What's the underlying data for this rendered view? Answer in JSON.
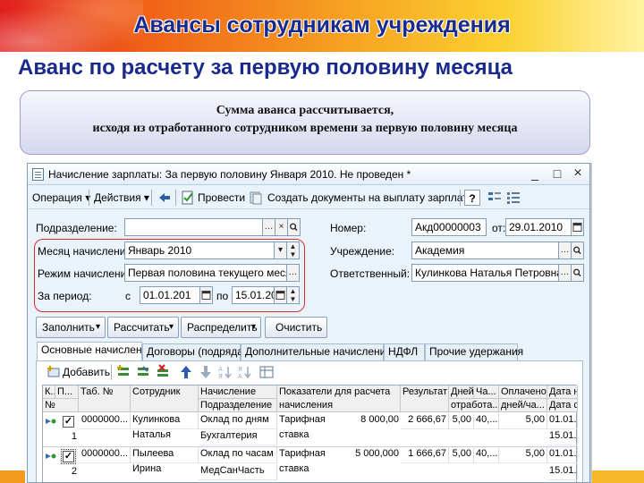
{
  "slide": {
    "title": "Авансы сотрудникам учреждения",
    "subtitle": "Аванс по расчету за первую половину месяца",
    "note_line1": "Сумма аванса рассчитывается,",
    "note_line2": "исходя из отработанного сотрудником времени за первую половину месяца"
  },
  "window": {
    "title": "Начисление зарплаты: За первую половину Января 2010. Не проведен *",
    "minimize": "_",
    "maximize": "□",
    "close": "×"
  },
  "toolbar": {
    "operation": "Операция ▾",
    "actions": "Действия ▾",
    "post": "Провести",
    "create_docs": "Создать документы на выплату зарплаты",
    "help": "?"
  },
  "form": {
    "department_label": "Подразделение:",
    "department_value": "",
    "number_label": "Номер:",
    "number_value": "Акд00000003",
    "date_label": "от:",
    "date_value": "29.01.2010",
    "month_label": "Месяц начисления:",
    "month_value": "Январь 2010",
    "institution_label": "Учреждение:",
    "institution_value": "Академия",
    "mode_label": "Режим начисления:",
    "mode_value": "Первая половина текущего месяца",
    "responsible_label": "Ответственный:",
    "responsible_value": "Кулинкова Наталья Петровна",
    "period_label": "За период:",
    "from_label": "с",
    "from_value": "01.01.201",
    "to_label": "по",
    "to_value": "15.01.20"
  },
  "actions": {
    "fill": "Заполнить",
    "calculate": "Рассчитать",
    "distribute": "Распределить",
    "clear": "Очистить"
  },
  "tabs": [
    {
      "label": "Основные начисления"
    },
    {
      "label": "Договоры (подряда)"
    },
    {
      "label": "Дополнительные начисления"
    },
    {
      "label": "НДФЛ"
    },
    {
      "label": "Прочие удержания"
    }
  ],
  "grid": {
    "add_label": "Добавить",
    "headers": {
      "k": "К...",
      "p": "П...",
      "no": "№",
      "tab": "Таб. №",
      "employee": "Сотрудник",
      "accrual": "Начисление",
      "department": "Подразделение",
      "indicators": "Показатели для расчета начисления",
      "result": "Результат",
      "days": "Дней",
      "days2": "отработа...",
      "ch": "Ча...",
      "paid": "Оплачено",
      "paid2": "дней/ча...",
      "date": "Дата н",
      "date2": "Дата с"
    },
    "rows": [
      {
        "no": "1",
        "checked": "✓",
        "tab": "0000000...",
        "employee1": "Кулинкова",
        "employee2": "Наталья",
        "accrual": "Оклад по дням",
        "department": "Бухгалтерия",
        "ind_name1": "Тарифная",
        "ind_name2": "ставка",
        "ind_value": "8 000,00",
        "result": "2 666,67",
        "days": "5,00",
        "hours": "40,...",
        "paid": "5,00",
        "date1": "01.01.",
        "date2": "15.01."
      },
      {
        "no": "2",
        "checked": "✓",
        "tab": "0000000...",
        "employee1": "Пылеева",
        "employee2": "Ирина",
        "accrual": "Оклад по часам",
        "department": "МедСанЧасть",
        "ind_name1": "Тарифная",
        "ind_name2": "ставка",
        "ind_value": "5 000,000",
        "result": "1 666,67",
        "days": "5,00",
        "hours": "40,...",
        "paid": "5,00",
        "date1": "01.01.",
        "date2": "15.01."
      }
    ]
  }
}
